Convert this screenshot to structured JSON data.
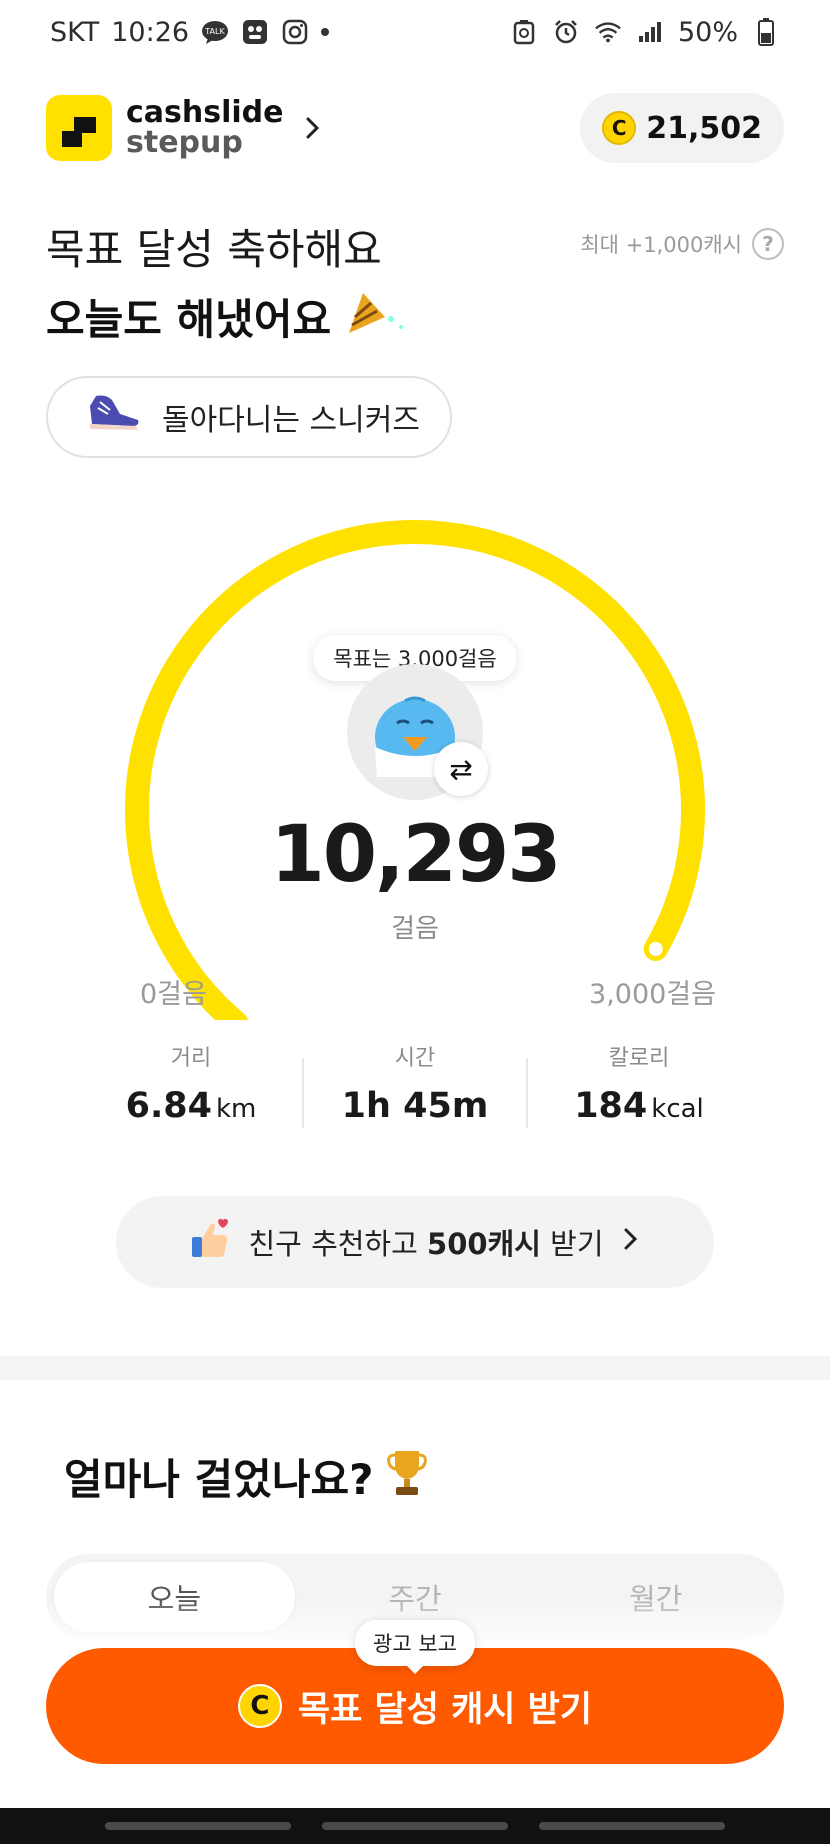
{
  "status_bar": {
    "carrier": "SKT",
    "time": "10:26",
    "battery": "50%",
    "icons": [
      "talk-icon",
      "chat-icon",
      "instagram-icon",
      "recycle-icon",
      "alarm-icon",
      "wifi-icon",
      "signal-icon",
      "battery-icon"
    ]
  },
  "header": {
    "brand_line1": "cashslide",
    "brand_line2": "stepup",
    "coin_symbol": "C",
    "coin_balance": "21,502"
  },
  "greeting": {
    "line1": "목표 달성 축하해요",
    "line2": "오늘도 해냈어요",
    "max_reward": "최대 +1,000캐시",
    "help": "?"
  },
  "sneaker": {
    "label": "돌아다니는 스니커즈"
  },
  "gauge": {
    "target_tooltip": "목표는 3,000걸음",
    "steps": "10,293",
    "unit": "걸음",
    "min_label": "0걸음",
    "max_label": "3,000걸음",
    "progress": 1.0,
    "accent": "#FFE100",
    "swap_symbol": "⇄"
  },
  "stats": [
    {
      "label": "거리",
      "value": "6.84",
      "unit": "km"
    },
    {
      "label": "시간",
      "value": "1h 45m",
      "unit": ""
    },
    {
      "label": "칼로리",
      "value": "184",
      "unit": "kcal"
    }
  ],
  "referral": {
    "prefix": "친구 추천하고 ",
    "bold": "500캐시",
    "suffix": " 받기"
  },
  "section": {
    "title": "얼마나 걸었나요?"
  },
  "tabs": [
    {
      "label": "오늘",
      "active": true
    },
    {
      "label": "주간",
      "active": false
    },
    {
      "label": "월간",
      "active": false
    }
  ],
  "cta": {
    "tooltip": "광고 보고",
    "coin_symbol": "C",
    "label": "목표 달성 캐시 받기",
    "color": "#FF5A00"
  }
}
